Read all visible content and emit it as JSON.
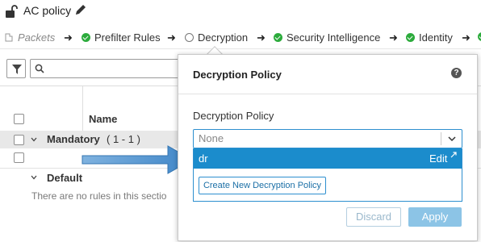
{
  "header": {
    "title": "AC policy",
    "lock_icon": "lock-open-icon",
    "edit_icon": "pencil-icon"
  },
  "steps": [
    {
      "label": "Packets",
      "state": "start"
    },
    {
      "label": "Prefilter Rules",
      "state": "done"
    },
    {
      "label": "Decryption",
      "state": "pending"
    },
    {
      "label": "Security Intelligence",
      "state": "done"
    },
    {
      "label": "Identity",
      "state": "done"
    }
  ],
  "table": {
    "columns": [
      "Name"
    ],
    "groups": [
      {
        "label": "Mandatory",
        "count": "( 1 - 1 )"
      },
      {
        "label": "Default",
        "count": ""
      }
    ],
    "empty_message": "There are no rules in this sectio"
  },
  "popup": {
    "title": "Decryption Policy",
    "help_icon_text": "?",
    "field_label": "Decryption Policy",
    "select_value": "None",
    "options": [
      {
        "label": "dr",
        "action": "Edit"
      }
    ],
    "create_button": "Create New Decryption Policy",
    "discard_button": "Discard",
    "apply_button": "Apply"
  },
  "colors": {
    "accent": "#1b8ccc",
    "check_green": "#2cab3c",
    "callout_blue": "#3f86c8"
  }
}
